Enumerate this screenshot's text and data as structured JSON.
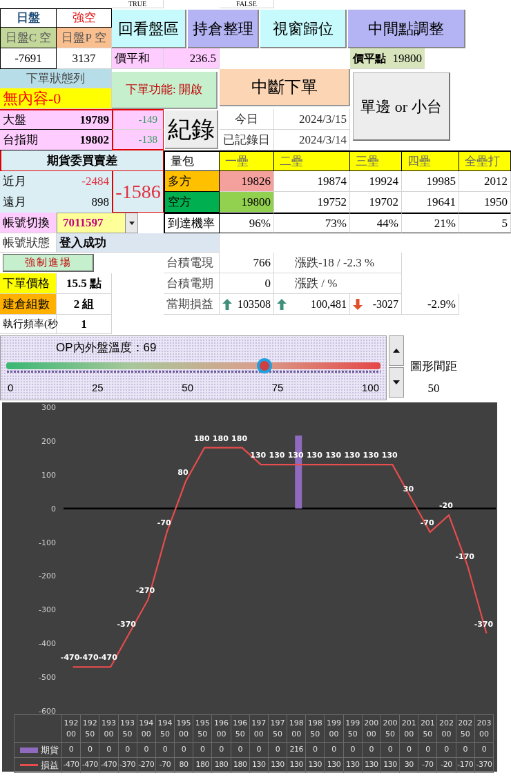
{
  "top_row": [
    "TRUE",
    "FALSE"
  ],
  "session": {
    "label": "日盤",
    "mode": "強空",
    "call_label": "日盤C 空",
    "put_label": "日盤P 空",
    "call_value": "-7691",
    "put_value": "3137"
  },
  "buttons": [
    {
      "label": "回看盤區"
    },
    {
      "label": "持倉整理"
    },
    {
      "label": "視窗歸位"
    },
    {
      "label": "中間點調整"
    }
  ],
  "price_sum": {
    "label": "價平和",
    "value": "236.5"
  },
  "atm_point": {
    "label": "價平點",
    "value": "19800"
  },
  "order_status": {
    "title": "下單狀態列",
    "message": "無內容-0"
  },
  "order_function": "下單功能: 開啟",
  "stop_button": "中斷下單",
  "side_button": "單邊 or 小台",
  "record_button": "紀錄",
  "quotes": [
    {
      "label": "大盤",
      "value": "19789",
      "diff": "-149"
    },
    {
      "label": "台指期",
      "value": "19802",
      "diff": "-138"
    }
  ],
  "dates": [
    {
      "label": "今日",
      "value": "2024/3/15"
    },
    {
      "label": "已記錄日",
      "value": "2024/3/14"
    }
  ],
  "futures_spread": {
    "title": "期貨委買賣差",
    "rows": [
      {
        "label": "近月",
        "value": "-2484",
        "negative": true
      },
      {
        "label": "遠月",
        "value": "898",
        "negative": false
      }
    ],
    "total": "-1586"
  },
  "bases": {
    "header": [
      "量包",
      "一壘",
      "二壘",
      "三壘",
      "四壘",
      "全壘打"
    ],
    "rows": [
      {
        "label": "多方",
        "values": [
          "19826",
          "19874",
          "19924",
          "19985",
          "2012"
        ]
      },
      {
        "label": "空方",
        "values": [
          "19800",
          "19752",
          "19702",
          "19641",
          "1950"
        ]
      },
      {
        "label": "到達機率",
        "values": [
          "96%",
          "73%",
          "44%",
          "21%",
          "5"
        ]
      }
    ]
  },
  "account": {
    "switch_label": "帳號切換",
    "account_id": "7011597",
    "status_label": "帳號狀態",
    "status": "登入成功"
  },
  "force_entry": "強制進場",
  "settings": [
    {
      "label": "下單價格",
      "value": "15.5 點"
    },
    {
      "label": "建倉組數",
      "value": "2 組"
    },
    {
      "label": "執行頻率(秒",
      "value": "1"
    }
  ],
  "tsmc": [
    {
      "label": "台積電現",
      "value": "766",
      "change": "漲跌-18 / -2.3 %"
    },
    {
      "label": "台積電期",
      "value": "0",
      "change": "漲跌 /  %"
    }
  ],
  "pnl": {
    "label": "當期損益",
    "items": [
      {
        "value": "103508",
        "up": true
      },
      {
        "value": "100,481",
        "up": true
      },
      {
        "value": "-3027",
        "up": false
      }
    ],
    "percent": "-2.9%"
  },
  "temperature": {
    "title": "OP內外盤溫度：69",
    "level": 0.69,
    "ticks": [
      "0",
      "25",
      "50",
      "75",
      "100"
    ]
  },
  "spacing": {
    "label": "圖形間距",
    "value": "50"
  },
  "chart": {
    "chart_data": {
      "type": "line",
      "categories": [
        "19200",
        "19250",
        "19300",
        "19350",
        "19400",
        "19450",
        "19500",
        "19550",
        "19600",
        "19650",
        "19700",
        "19750",
        "19800",
        "19850",
        "19900",
        "19950",
        "20000",
        "20050",
        "20100",
        "20150",
        "20200",
        "20250",
        "20300"
      ],
      "series": [
        {
          "name": "期貨",
          "type": "bar",
          "color": "#8e6bbf",
          "values": [
            0,
            0,
            0,
            0,
            0,
            0,
            0,
            0,
            0,
            0,
            0,
            0,
            216,
            0,
            0,
            0,
            0,
            0,
            0,
            0,
            0,
            0,
            0
          ]
        },
        {
          "name": "損益",
          "color": "#e84c4c",
          "values": [
            -470,
            -470,
            -470,
            -370,
            -270,
            -70,
            80,
            180,
            180,
            180,
            130,
            130,
            130,
            130,
            130,
            130,
            130,
            130,
            30,
            -70,
            -20,
            -170,
            -370
          ]
        }
      ],
      "ylim": [
        -600,
        300
      ],
      "yticks": [
        -600,
        -500,
        -400,
        -300,
        -200,
        -100,
        0,
        100,
        200,
        300
      ],
      "legend": "bottom",
      "value_labels": [
        "-470",
        "-470",
        "-470",
        "-370",
        "-270",
        "-70",
        "80",
        "180",
        "180",
        "180",
        "130",
        "130",
        "130",
        "130",
        "130",
        "130",
        "130",
        "130",
        "30",
        "-70",
        "-20",
        "-170",
        "-370"
      ]
    },
    "data_table": [
      {
        "values": [
          "0",
          "0",
          "0",
          "0",
          "0",
          "0",
          "0",
          "0",
          "0",
          "0",
          "0",
          "0",
          "216",
          "0",
          "0",
          "0",
          "0",
          "0",
          "0",
          "0",
          "0",
          "0",
          "0"
        ]
      },
      {
        "values": [
          "-470",
          "-470",
          "-470",
          "-370",
          "-270",
          "-70",
          "80",
          "180",
          "180",
          "180",
          "130",
          "130",
          "130",
          "130",
          "130",
          "130",
          "130",
          "130",
          "30",
          "-70",
          "-20",
          "-170",
          "-370"
        ]
      }
    ]
  }
}
